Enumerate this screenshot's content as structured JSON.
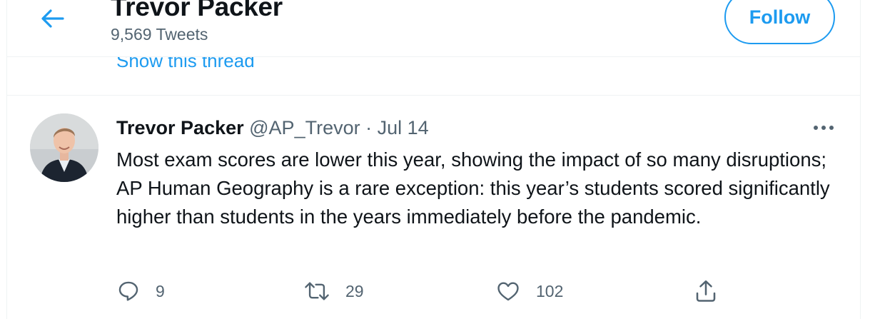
{
  "header": {
    "title": "Trevor Packer",
    "tweet_count": "9,569 Tweets",
    "follow_label": "Follow"
  },
  "previous_tweet": {
    "show_thread": "Show this thread"
  },
  "tweet": {
    "author_name": "Trevor Packer",
    "handle": "@AP_Trevor",
    "separator": "·",
    "date": "Jul 14",
    "text": "Most exam scores are lower this year, showing the impact of so many disruptions; AP Human Geography is a rare exception: this year’s students scored significantly higher than students in the years immediately before the pandemic.",
    "actions": {
      "replies": "9",
      "retweets": "29",
      "likes": "102"
    }
  },
  "colors": {
    "accent": "#1d9bf0",
    "secondary_text": "#536471",
    "primary_text": "#0f1419",
    "border": "#eff3f4"
  },
  "icons": [
    "back-arrow-icon",
    "more-icon",
    "reply-icon",
    "retweet-icon",
    "like-icon",
    "share-icon"
  ]
}
